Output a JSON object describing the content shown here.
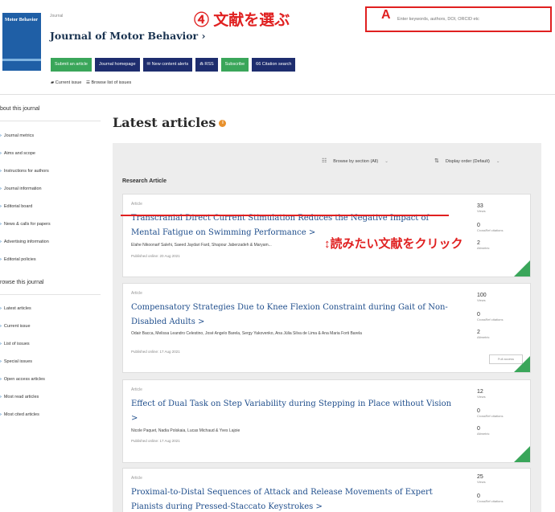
{
  "header": {
    "journal_tag": "Journal",
    "journal_title": "Journal of Motor Behavior",
    "title_chevron": "›",
    "cover_logo": "Motor Behavior"
  },
  "annotations": {
    "step": "④ 文献を選ぶ",
    "search_marker": "A",
    "click_hint": "↕読みたい文献をクリック"
  },
  "search": {
    "placeholder": "Enter keywords, authors, DOI, ORCID etc"
  },
  "buttons": [
    {
      "label": "Submit an article"
    },
    {
      "label": "Journal homepage"
    },
    {
      "label": "✉ New content alerts"
    },
    {
      "label": "⋒ RSS"
    },
    {
      "label": "Subscribe"
    },
    {
      "label": "66 Citation search"
    }
  ],
  "sublinks": {
    "current_issue": "▰ Current issue",
    "browse_issues": "☰ Browse list of issues"
  },
  "sidebar": {
    "about_heading": "bout this journal",
    "about_items": [
      "Journal metrics",
      "Aims and scope",
      "Instructions for authors",
      "Journal information",
      "Editorial board",
      "News & calls for papers",
      "Advertising information",
      "Editorial policies"
    ],
    "browse_heading": "rowse this journal",
    "browse_items": [
      "Latest articles",
      "Current issue",
      "List of issues",
      "Special issues",
      "Open access articles",
      "Most read articles",
      "Most cited articles"
    ]
  },
  "main": {
    "heading": "Latest articles",
    "info_icon": "i",
    "browse_by_section": "Browse by section (All)",
    "display_order": "Display order (Default)",
    "section_label": "Research Article",
    "articles": [
      {
        "type": "Article",
        "title": "Transcranial Direct Current Stimulation Reduces the Negative Impact of Mental Fatigue on Swimming Performance",
        "authors": "Elahe Nikoonarf Salehi, Saeed Jaydari Fard, Shapour Jaberzadeh & Maryam...",
        "published": "Published online: 20 Aug 2021",
        "views": "33",
        "crossref": "0",
        "altmetric": "2"
      },
      {
        "type": "Article",
        "title": "Compensatory Strategies Due to Knee Flexion Constraint during Gait of Non-Disabled Adults",
        "authors": "Odair Bacca, Melissa Leandro Celestino, José Angelo Barela, Sergy Yakovenko, Ana Júlia Silva de Lima & Ana Maria Forti Barela",
        "published": "Published online: 17 Aug 2021",
        "views": "100",
        "crossref": "0",
        "altmetric": "2",
        "access": "Full access"
      },
      {
        "type": "Article",
        "title": "Effect of Dual Task on Step Variability during Stepping in Place without Vision",
        "authors": "Nicole Paquet, Nadia Polskaia, Lucas Michaud & Yves Lajoie",
        "published": "Published online: 17 Aug 2021",
        "views": "12",
        "crossref": "0",
        "altmetric": "0"
      },
      {
        "type": "Article",
        "title": "Proximal-to-Distal Sequences of Attack and Release Movements of Expert Pianists during Pressed-Staccato Keystrokes",
        "authors": "",
        "published": "",
        "views": "25",
        "crossref": "0",
        "altmetric": ""
      }
    ],
    "metric_labels": {
      "views": "Views",
      "crossref": "CrossRef citations",
      "altmetric": "Altmetric"
    },
    "link_arrow": ">"
  }
}
